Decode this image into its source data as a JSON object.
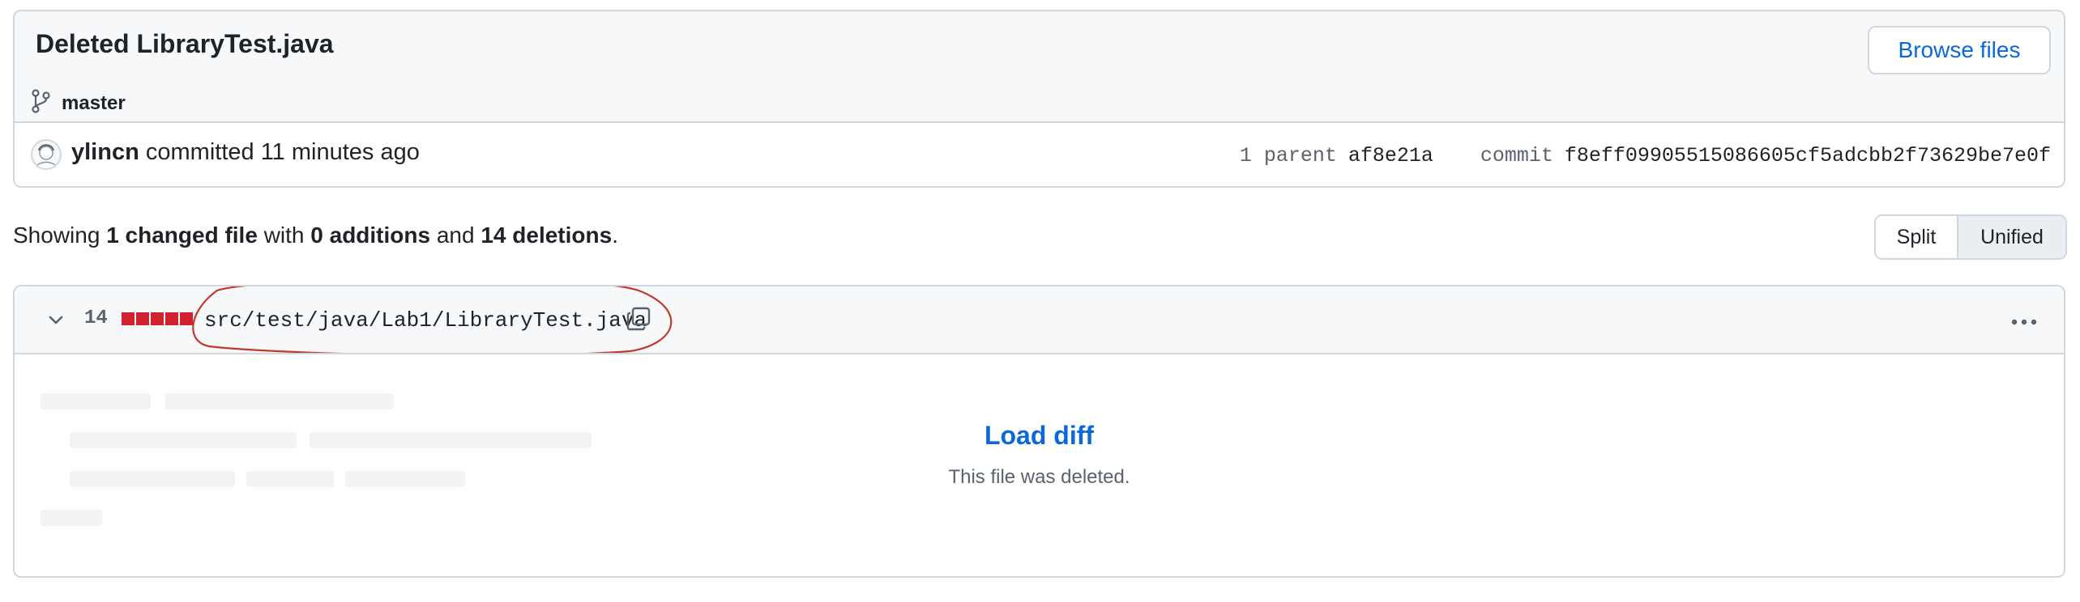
{
  "commit": {
    "title": "Deleted LibraryTest.java",
    "branch": "master",
    "browse_button": "Browse files",
    "author": "ylincn",
    "committed_text": "committed 11 minutes ago",
    "parent_label": "1 parent",
    "parent_sha": "af8e21a",
    "commit_label": "commit",
    "commit_sha": "f8eff09905515086605cf5adcbb2f73629be7e0f"
  },
  "summary": {
    "prefix": "Showing",
    "changed": "1 changed file",
    "with": "with",
    "additions": "0 additions",
    "and": "and",
    "deletions": "14 deletions",
    "suffix": "."
  },
  "view_toggle": {
    "split": "Split",
    "unified": "Unified",
    "selected": "Unified"
  },
  "file": {
    "deletion_count": "14",
    "path": "src/test/java/Lab1/LibraryTest.java",
    "load_diff": "Load diff",
    "note": "This file was deleted.",
    "diffstat_color": "#cf222e"
  },
  "colors": {
    "link": "#0969da",
    "annotation": "#c0392b"
  }
}
